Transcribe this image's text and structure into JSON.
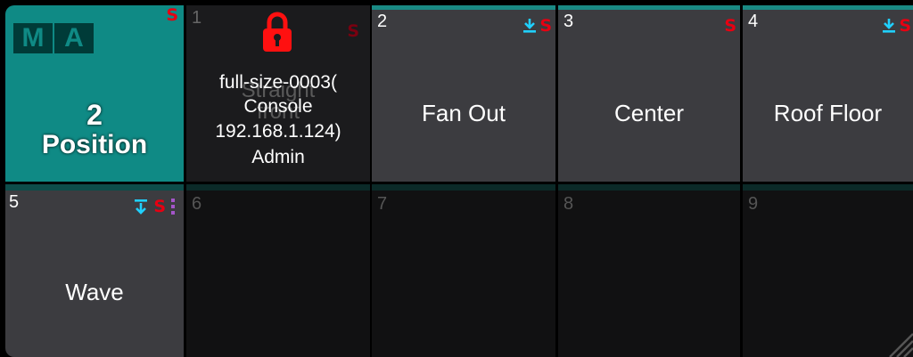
{
  "colors": {
    "teal": "#0f8a85",
    "teal_bar": "#1a8a84",
    "preset_tile_bg": "#3c3c40",
    "empty_tile_bg": "#111112",
    "badge_red": "#e60012",
    "download_cyan": "#20d0ff",
    "purple_dots": "#a455c9"
  },
  "header_tile": {
    "logo_left": "M",
    "logo_right": "A",
    "badge": "S",
    "pool_number": "2",
    "pool_name": "Position"
  },
  "locked_tile": {
    "number": "1",
    "badge": "S",
    "lines": [
      "full-size-0003(",
      "Console",
      "192.168.1.124)",
      "Admin"
    ],
    "ghost_lines": [
      "Straight",
      "front"
    ]
  },
  "presets": [
    {
      "number": "2",
      "label": "Fan Out",
      "badges": [
        "download",
        "S"
      ]
    },
    {
      "number": "3",
      "label": "Center",
      "badges": [
        "S"
      ]
    },
    {
      "number": "4",
      "label": "Roof Floor",
      "badges": [
        "download",
        "S"
      ]
    },
    {
      "number": "5",
      "label": "Wave",
      "badges": [
        "download",
        "S",
        "dots"
      ]
    }
  ],
  "empty_slots": [
    "6",
    "7",
    "8",
    "9"
  ]
}
